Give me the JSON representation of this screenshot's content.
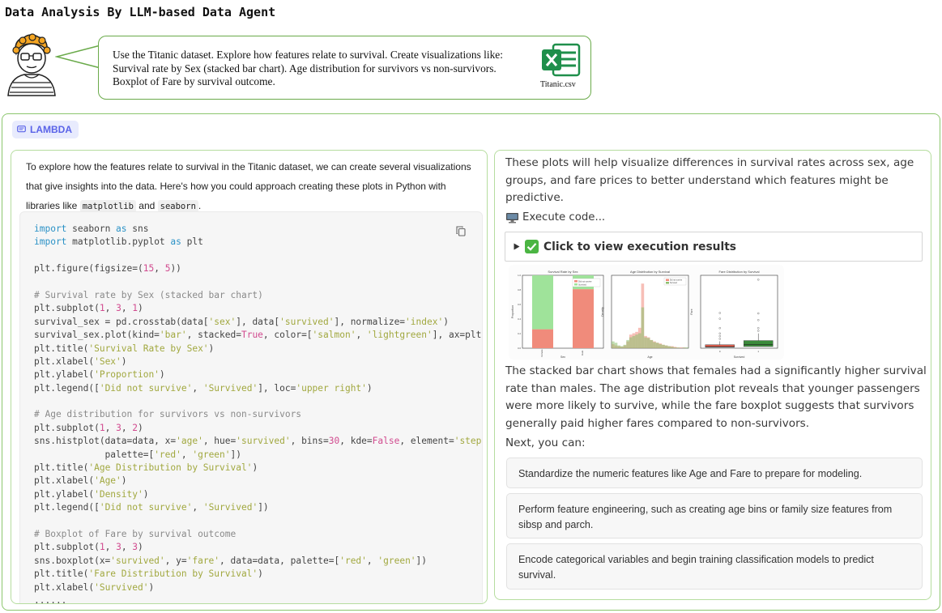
{
  "page_title": "Data Analysis By LLM-based Data Agent",
  "prompt": {
    "text": "Use the Titanic dataset. Explore how features relate to survival. Create visualizations like: Survival rate by Sex (stacked bar chart). Age distribution for survivors vs non-survivors. Boxplot of Fare by survival outcome.",
    "attachment_icon": "excel-file-icon",
    "attachment_name": "Titanic.csv"
  },
  "agent": {
    "badge_label": "LAMBDA",
    "badge_icon": "chat-icon"
  },
  "left": {
    "intro_part1": "To explore how the features relate to survival in the Titanic dataset, we can create several visualizations that give insights into the data. Here's how you could approach creating these plots in Python with libraries like",
    "lib1": "matplotlib",
    "and_word": "and",
    "lib2": "seaborn",
    "period": ".",
    "code_lines": [
      [
        [
          "kw",
          "import"
        ],
        [
          "p",
          " seaborn "
        ],
        [
          "kw",
          "as"
        ],
        [
          "p",
          " sns"
        ]
      ],
      [
        [
          "kw",
          "import"
        ],
        [
          "p",
          " matplotlib.pyplot "
        ],
        [
          "kw",
          "as"
        ],
        [
          "p",
          " plt"
        ]
      ],
      [],
      [
        [
          "p",
          "plt.figure(figsize=("
        ],
        [
          "num",
          "15"
        ],
        [
          "p",
          ", "
        ],
        [
          "num",
          "5"
        ],
        [
          "p",
          "))"
        ]
      ],
      [],
      [
        [
          "com",
          "# Survival rate by Sex (stacked bar chart)"
        ]
      ],
      [
        [
          "p",
          "plt.subplot("
        ],
        [
          "num",
          "1"
        ],
        [
          "p",
          ", "
        ],
        [
          "num",
          "3"
        ],
        [
          "p",
          ", "
        ],
        [
          "num",
          "1"
        ],
        [
          "p",
          ")"
        ]
      ],
      [
        [
          "p",
          "survival_sex = pd.crosstab(data["
        ],
        [
          "str",
          "'sex'"
        ],
        [
          "p",
          "], data["
        ],
        [
          "str",
          "'survived'"
        ],
        [
          "p",
          "], normalize="
        ],
        [
          "str",
          "'index'"
        ],
        [
          "p",
          ")"
        ]
      ],
      [
        [
          "p",
          "survival_sex.plot(kind="
        ],
        [
          "str",
          "'bar'"
        ],
        [
          "p",
          ", stacked="
        ],
        [
          "true",
          "True"
        ],
        [
          "p",
          ", color=["
        ],
        [
          "str",
          "'salmon'"
        ],
        [
          "p",
          ", "
        ],
        [
          "str",
          "'lightgreen'"
        ],
        [
          "p",
          "], ax=plt."
        ]
      ],
      [
        [
          "p",
          "plt.title("
        ],
        [
          "str",
          "'Survival Rate by Sex'"
        ],
        [
          "p",
          ")"
        ]
      ],
      [
        [
          "p",
          "plt.xlabel("
        ],
        [
          "str",
          "'Sex'"
        ],
        [
          "p",
          ")"
        ]
      ],
      [
        [
          "p",
          "plt.ylabel("
        ],
        [
          "str",
          "'Proportion'"
        ],
        [
          "p",
          ")"
        ]
      ],
      [
        [
          "p",
          "plt.legend(["
        ],
        [
          "str",
          "'Did not survive'"
        ],
        [
          "p",
          ", "
        ],
        [
          "str",
          "'Survived'"
        ],
        [
          "p",
          "], loc="
        ],
        [
          "str",
          "'upper right'"
        ],
        [
          "p",
          ")"
        ]
      ],
      [],
      [
        [
          "com",
          "# Age distribution for survivors vs non-survivors"
        ]
      ],
      [
        [
          "p",
          "plt.subplot("
        ],
        [
          "num",
          "1"
        ],
        [
          "p",
          ", "
        ],
        [
          "num",
          "3"
        ],
        [
          "p",
          ", "
        ],
        [
          "num",
          "2"
        ],
        [
          "p",
          ")"
        ]
      ],
      [
        [
          "p",
          "sns.histplot(data=data, x="
        ],
        [
          "str",
          "'age'"
        ],
        [
          "p",
          ", hue="
        ],
        [
          "str",
          "'survived'"
        ],
        [
          "p",
          ", bins="
        ],
        [
          "num",
          "30"
        ],
        [
          "p",
          ", kde="
        ],
        [
          "true",
          "False"
        ],
        [
          "p",
          ", element="
        ],
        [
          "str",
          "'step'"
        ]
      ],
      [
        [
          "p",
          "             palette=["
        ],
        [
          "str",
          "'red'"
        ],
        [
          "p",
          ", "
        ],
        [
          "str",
          "'green'"
        ],
        [
          "p",
          "])"
        ]
      ],
      [
        [
          "p",
          "plt.title("
        ],
        [
          "str",
          "'Age Distribution by Survival'"
        ],
        [
          "p",
          ")"
        ]
      ],
      [
        [
          "p",
          "plt.xlabel("
        ],
        [
          "str",
          "'Age'"
        ],
        [
          "p",
          ")"
        ]
      ],
      [
        [
          "p",
          "plt.ylabel("
        ],
        [
          "str",
          "'Density'"
        ],
        [
          "p",
          ")"
        ]
      ],
      [
        [
          "p",
          "plt.legend(["
        ],
        [
          "str",
          "'Did not survive'"
        ],
        [
          "p",
          ", "
        ],
        [
          "str",
          "'Survived'"
        ],
        [
          "p",
          "])"
        ]
      ],
      [],
      [
        [
          "com",
          "# Boxplot of Fare by survival outcome"
        ]
      ],
      [
        [
          "p",
          "plt.subplot("
        ],
        [
          "num",
          "1"
        ],
        [
          "p",
          ", "
        ],
        [
          "num",
          "3"
        ],
        [
          "p",
          ", "
        ],
        [
          "num",
          "3"
        ],
        [
          "p",
          ")"
        ]
      ],
      [
        [
          "p",
          "sns.boxplot(x="
        ],
        [
          "str",
          "'survived'"
        ],
        [
          "p",
          ", y="
        ],
        [
          "str",
          "'fare'"
        ],
        [
          "p",
          ", data=data, palette=["
        ],
        [
          "str",
          "'red'"
        ],
        [
          "p",
          ", "
        ],
        [
          "str",
          "'green'"
        ],
        [
          "p",
          "])"
        ]
      ],
      [
        [
          "p",
          "plt.title("
        ],
        [
          "str",
          "'Fare Distribution by Survival'"
        ],
        [
          "p",
          ")"
        ]
      ],
      [
        [
          "p",
          "plt.xlabel("
        ],
        [
          "str",
          "'Survived'"
        ],
        [
          "p",
          ")"
        ]
      ],
      [
        [
          "p",
          "......"
        ]
      ]
    ]
  },
  "right": {
    "para1": "These plots will help visualize differences in survival rates across sex, age groups, and fare prices to better understand which features might be predictive.",
    "exec_icon": "monitor-icon",
    "exec_label": "Execute code...",
    "details_label": "Click to view execution results",
    "para2": "The stacked bar chart shows that females had a significantly higher survival rate than males. The age distribution plot reveals that younger passengers were more likely to survive, while the fare boxplot suggests that survivors generally paid higher fares compared to non-survivors.",
    "next_label": "Next, you can:",
    "suggestions": [
      "Standardize the numeric features like Age and Fare to prepare for modeling.",
      "Perform feature engineering, such as creating age bins or family size features from sibsp and parch.",
      "Encode categorical variables and begin training classification models to predict survival."
    ]
  },
  "chart_data": [
    {
      "type": "bar",
      "title": "Survival Rate by Sex",
      "categories": [
        "female",
        "male"
      ],
      "series": [
        {
          "name": "Did not survive",
          "values": [
            0.26,
            0.81
          ]
        },
        {
          "name": "Survived",
          "values": [
            0.74,
            0.19
          ]
        }
      ],
      "xlabel": "Sex",
      "ylabel": "Proportion",
      "ylim": [
        0,
        1
      ],
      "stacked": true,
      "colors": [
        "#f08b7b",
        "#9fe39a"
      ],
      "legend": "top-right"
    },
    {
      "type": "bar",
      "title": "Age Distribution by Survival",
      "xlabel": "Age",
      "ylabel": "Density",
      "x": [
        2,
        5,
        8,
        11,
        14,
        17,
        20,
        23,
        26,
        29,
        32,
        35,
        38,
        41,
        44,
        47,
        50,
        53,
        56,
        59,
        62,
        65,
        68,
        71,
        74,
        77
      ],
      "series": [
        {
          "name": "Did not survive",
          "values": [
            6,
            4,
            3,
            2,
            4,
            10,
            20,
            22,
            24,
            30,
            95,
            18,
            16,
            12,
            10,
            8,
            7,
            5,
            4,
            3,
            3,
            2,
            1,
            1,
            1,
            0
          ]
        },
        {
          "name": "Survived",
          "values": [
            10,
            8,
            4,
            3,
            5,
            12,
            16,
            18,
            20,
            22,
            60,
            16,
            15,
            12,
            9,
            8,
            6,
            5,
            4,
            3,
            2,
            1,
            1,
            0,
            1,
            1
          ]
        }
      ],
      "colors": [
        "#f08b7b",
        "#8cbf6e"
      ],
      "legend": "top-right"
    },
    {
      "type": "box",
      "title": "Fare Distribution by Survival",
      "categories": [
        "0",
        "1"
      ],
      "xlabel": "Survived",
      "ylabel": "Fare",
      "boxes": [
        {
          "q1": 7.9,
          "median": 10.5,
          "q3": 26,
          "whisker_high": 52,
          "outliers": [
            70,
            90,
            110,
            150,
            220,
            263
          ]
        },
        {
          "q1": 12.5,
          "median": 26,
          "q3": 57,
          "whisker_high": 110,
          "outliers": [
            130,
            150,
            210,
            260,
            512
          ]
        }
      ],
      "colors": [
        "#d45a4a",
        "#3a8a3a"
      ]
    }
  ]
}
